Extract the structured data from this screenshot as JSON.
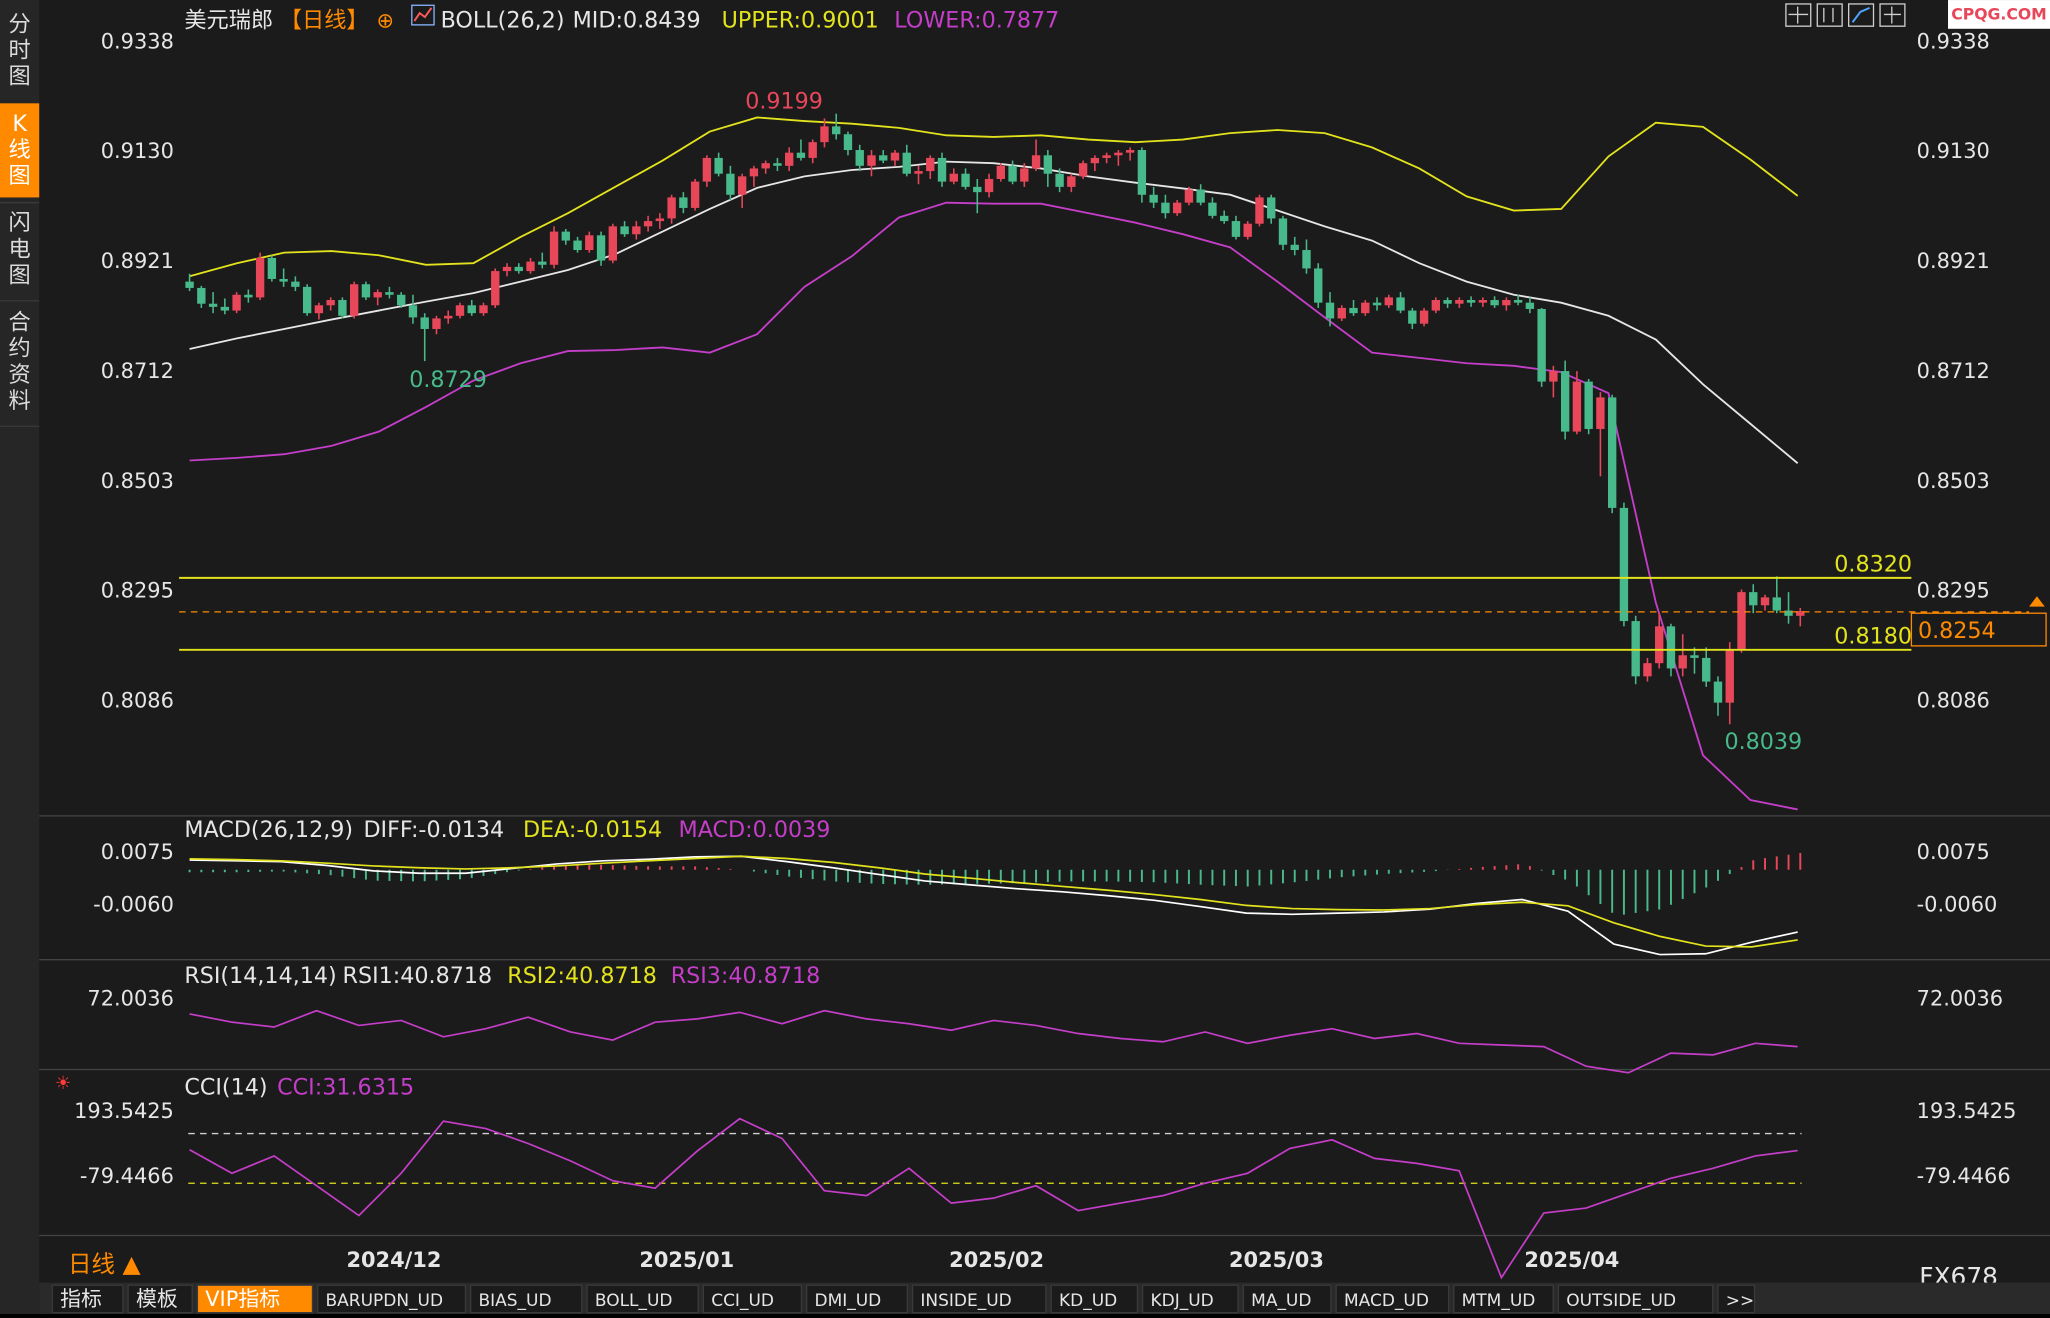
{
  "header": {
    "symbol": "美元瑞郎",
    "period_tag": "【日线】",
    "boll": {
      "name": "BOLL(26,2)",
      "mid": "MID:0.8439",
      "upper": "UPPER:0.9001",
      "lower": "LOWER:0.7877"
    },
    "watermark": "CPQG.COM"
  },
  "left_tabs": [
    {
      "label": "分\n时\n图",
      "active": false
    },
    {
      "label": "K\n线\n图",
      "active": true
    },
    {
      "label": "闪\n电\n图",
      "active": false
    },
    {
      "label": "合\n约\n资\n料",
      "active": false
    }
  ],
  "price_axis": [
    "0.9338",
    "0.9130",
    "0.8921",
    "0.8712",
    "0.8503",
    "0.8295",
    "0.8086"
  ],
  "price_annotations": {
    "high": "0.9199",
    "low_early": "0.8729",
    "low": "0.8039",
    "line_upper": "0.8320",
    "line_lower": "0.8180",
    "current": "0.8254"
  },
  "macd": {
    "header": "MACD(26,12,9)",
    "diff": "DIFF:-0.0134",
    "dea": "DEA:-0.0154",
    "macd": "MACD:0.0039",
    "axis": [
      "0.0075",
      "-0.0060"
    ]
  },
  "rsi": {
    "header": "RSI(14,14,14)",
    "rsi1": "RSI1:40.8718",
    "rsi2": "RSI2:40.8718",
    "rsi3": "RSI3:40.8718",
    "axis": [
      "72.0036"
    ]
  },
  "cci": {
    "header": "CCI(14)",
    "value": "CCI:31.6315",
    "axis": [
      "193.5425",
      "-79.4466"
    ]
  },
  "x_axis": [
    "2024/12",
    "2025/01",
    "2025/02",
    "2025/03",
    "2025/04"
  ],
  "period_label": "日线 ▲",
  "product": "FX678",
  "bottom_tabs": [
    "指标",
    "模板",
    "VIP指标",
    "BARUPDN_UD",
    "BIAS_UD",
    "BOLL_UD",
    "CCI_UD",
    "DMI_UD",
    "INSIDE_UD",
    "KD_UD",
    "KDJ_UD",
    "MA_UD",
    "MACD_UD",
    "MTM_UD",
    "OUTSIDE_UD",
    ">>"
  ],
  "colors": {
    "up": "#e8475a",
    "down": "#48b98a",
    "upper": "#e3e31d",
    "mid": "#e6e6e6",
    "lower": "#c53ec9",
    "accent": "#ff8a00"
  },
  "chart_data": {
    "type": "candlestick",
    "ylim": [
      0.795,
      0.9338
    ],
    "candles": [
      [
        0.888,
        0.8895,
        0.8862,
        0.8868
      ],
      [
        0.8868,
        0.8872,
        0.883,
        0.8838
      ],
      [
        0.8838,
        0.886,
        0.882,
        0.8832
      ],
      [
        0.8832,
        0.8848,
        0.8818,
        0.8825
      ],
      [
        0.8825,
        0.886,
        0.882,
        0.8855
      ],
      [
        0.8855,
        0.8865,
        0.884,
        0.885
      ],
      [
        0.885,
        0.8935,
        0.8845,
        0.8925
      ],
      [
        0.8925,
        0.893,
        0.888,
        0.8885
      ],
      [
        0.8885,
        0.8905,
        0.887,
        0.888
      ],
      [
        0.888,
        0.889,
        0.8862,
        0.887
      ],
      [
        0.887,
        0.8875,
        0.8815,
        0.882
      ],
      [
        0.882,
        0.884,
        0.8808,
        0.8835
      ],
      [
        0.8835,
        0.885,
        0.8825,
        0.8845
      ],
      [
        0.8845,
        0.885,
        0.881,
        0.8815
      ],
      [
        0.8815,
        0.888,
        0.881,
        0.8875
      ],
      [
        0.8875,
        0.888,
        0.8845,
        0.885
      ],
      [
        0.885,
        0.8865,
        0.8835,
        0.886
      ],
      [
        0.886,
        0.887,
        0.8848,
        0.8855
      ],
      [
        0.8855,
        0.886,
        0.883,
        0.8835
      ],
      [
        0.8835,
        0.8855,
        0.88,
        0.8812
      ],
      [
        0.8812,
        0.882,
        0.8729,
        0.879
      ],
      [
        0.879,
        0.8815,
        0.878,
        0.881
      ],
      [
        0.881,
        0.8825,
        0.88,
        0.8815
      ],
      [
        0.8815,
        0.884,
        0.881,
        0.8835
      ],
      [
        0.8835,
        0.8845,
        0.8815,
        0.882
      ],
      [
        0.882,
        0.884,
        0.8815,
        0.8835
      ],
      [
        0.8835,
        0.8905,
        0.883,
        0.89
      ],
      [
        0.89,
        0.8915,
        0.889,
        0.8908
      ],
      [
        0.8908,
        0.8915,
        0.8895,
        0.89
      ],
      [
        0.89,
        0.8925,
        0.8895,
        0.8918
      ],
      [
        0.8918,
        0.8935,
        0.8905,
        0.8912
      ],
      [
        0.8912,
        0.8985,
        0.8905,
        0.8975
      ],
      [
        0.8975,
        0.898,
        0.895,
        0.8958
      ],
      [
        0.8958,
        0.8965,
        0.8935,
        0.894
      ],
      [
        0.894,
        0.8975,
        0.8935,
        0.8968
      ],
      [
        0.8968,
        0.8975,
        0.891,
        0.892
      ],
      [
        0.892,
        0.899,
        0.8915,
        0.8985
      ],
      [
        0.8985,
        0.8995,
        0.8965,
        0.897
      ],
      [
        0.897,
        0.8995,
        0.896,
        0.8985
      ],
      [
        0.8985,
        0.9005,
        0.8975,
        0.8995
      ],
      [
        0.8995,
        0.901,
        0.898,
        0.9
      ],
      [
        0.9,
        0.9045,
        0.899,
        0.904
      ],
      [
        0.904,
        0.905,
        0.901,
        0.902
      ],
      [
        0.902,
        0.9075,
        0.9015,
        0.907
      ],
      [
        0.907,
        0.912,
        0.906,
        0.9115
      ],
      [
        0.9115,
        0.9125,
        0.908,
        0.9085
      ],
      [
        0.9085,
        0.91,
        0.9035,
        0.9045
      ],
      [
        0.9045,
        0.9085,
        0.902,
        0.908
      ],
      [
        0.908,
        0.91,
        0.906,
        0.9095
      ],
      [
        0.9095,
        0.911,
        0.9085,
        0.9105
      ],
      [
        0.9105,
        0.9115,
        0.909,
        0.91
      ],
      [
        0.91,
        0.9135,
        0.909,
        0.9125
      ],
      [
        0.9125,
        0.915,
        0.911,
        0.9115
      ],
      [
        0.9115,
        0.915,
        0.9105,
        0.9145
      ],
      [
        0.9145,
        0.919,
        0.9135,
        0.9175
      ],
      [
        0.9175,
        0.9199,
        0.915,
        0.916
      ],
      [
        0.916,
        0.9165,
        0.912,
        0.913
      ],
      [
        0.913,
        0.914,
        0.909,
        0.91
      ],
      [
        0.91,
        0.913,
        0.908,
        0.912
      ],
      [
        0.912,
        0.913,
        0.9105,
        0.911
      ],
      [
        0.911,
        0.913,
        0.91,
        0.9125
      ],
      [
        0.9125,
        0.914,
        0.908,
        0.9085
      ],
      [
        0.9085,
        0.91,
        0.9065,
        0.909
      ],
      [
        0.909,
        0.912,
        0.9075,
        0.9115
      ],
      [
        0.9115,
        0.9125,
        0.906,
        0.907
      ],
      [
        0.907,
        0.9095,
        0.9065,
        0.9085
      ],
      [
        0.9085,
        0.9095,
        0.9055,
        0.906
      ],
      [
        0.906,
        0.9075,
        0.901,
        0.905
      ],
      [
        0.905,
        0.9085,
        0.904,
        0.9075
      ],
      [
        0.9075,
        0.9105,
        0.907,
        0.91
      ],
      [
        0.91,
        0.911,
        0.9065,
        0.907
      ],
      [
        0.907,
        0.9105,
        0.906,
        0.9095
      ],
      [
        0.9095,
        0.915,
        0.909,
        0.912
      ],
      [
        0.912,
        0.913,
        0.906,
        0.9085
      ],
      [
        0.9085,
        0.9095,
        0.905,
        0.906
      ],
      [
        0.906,
        0.9085,
        0.905,
        0.908
      ],
      [
        0.908,
        0.911,
        0.9075,
        0.9105
      ],
      [
        0.9105,
        0.912,
        0.909,
        0.9115
      ],
      [
        0.9115,
        0.9125,
        0.9105,
        0.912
      ],
      [
        0.912,
        0.913,
        0.91,
        0.9125
      ],
      [
        0.9125,
        0.9135,
        0.911,
        0.913
      ],
      [
        0.913,
        0.9135,
        0.903,
        0.9045
      ],
      [
        0.9045,
        0.906,
        0.902,
        0.903
      ],
      [
        0.903,
        0.9045,
        0.9,
        0.901
      ],
      [
        0.901,
        0.9035,
        0.9005,
        0.903
      ],
      [
        0.903,
        0.906,
        0.9025,
        0.9055
      ],
      [
        0.9055,
        0.9065,
        0.9025,
        0.903
      ],
      [
        0.903,
        0.904,
        0.9,
        0.9005
      ],
      [
        0.9005,
        0.9015,
        0.899,
        0.8995
      ],
      [
        0.8995,
        0.9005,
        0.896,
        0.8965
      ],
      [
        0.8965,
        0.8995,
        0.896,
        0.899
      ],
      [
        0.899,
        0.9045,
        0.8985,
        0.904
      ],
      [
        0.904,
        0.9045,
        0.899,
        0.9
      ],
      [
        0.9,
        0.9005,
        0.894,
        0.895
      ],
      [
        0.895,
        0.8965,
        0.893,
        0.894
      ],
      [
        0.894,
        0.896,
        0.8895,
        0.8905
      ],
      [
        0.8905,
        0.8915,
        0.883,
        0.884
      ],
      [
        0.884,
        0.886,
        0.8795,
        0.881
      ],
      [
        0.881,
        0.8835,
        0.8805,
        0.883
      ],
      [
        0.883,
        0.8845,
        0.8815,
        0.882
      ],
      [
        0.882,
        0.8845,
        0.8815,
        0.884
      ],
      [
        0.884,
        0.885,
        0.8825,
        0.8835
      ],
      [
        0.8835,
        0.8855,
        0.883,
        0.885
      ],
      [
        0.885,
        0.886,
        0.882,
        0.8825
      ],
      [
        0.8825,
        0.883,
        0.879,
        0.88
      ],
      [
        0.88,
        0.883,
        0.8795,
        0.8825
      ],
      [
        0.8825,
        0.885,
        0.882,
        0.8845
      ],
      [
        0.8845,
        0.885,
        0.883,
        0.8838
      ],
      [
        0.8838,
        0.885,
        0.883,
        0.8845
      ],
      [
        0.8845,
        0.8852,
        0.8832,
        0.884
      ],
      [
        0.884,
        0.885,
        0.8832,
        0.8845
      ],
      [
        0.8845,
        0.8852,
        0.883,
        0.8835
      ],
      [
        0.8835,
        0.885,
        0.8825,
        0.8845
      ],
      [
        0.8845,
        0.8855,
        0.8835,
        0.884
      ],
      [
        0.884,
        0.885,
        0.882,
        0.8828
      ],
      [
        0.8828,
        0.883,
        0.868,
        0.869
      ],
      [
        0.869,
        0.872,
        0.866,
        0.871
      ],
      [
        0.871,
        0.873,
        0.858,
        0.8595
      ],
      [
        0.8595,
        0.871,
        0.859,
        0.869
      ],
      [
        0.869,
        0.8695,
        0.859,
        0.86
      ],
      [
        0.86,
        0.867,
        0.851,
        0.866
      ],
      [
        0.866,
        0.8665,
        0.844,
        0.845
      ],
      [
        0.845,
        0.846,
        0.8225,
        0.8235
      ],
      [
        0.8235,
        0.8245,
        0.8115,
        0.813
      ],
      [
        0.813,
        0.8165,
        0.812,
        0.8155
      ],
      [
        0.8155,
        0.825,
        0.8145,
        0.8225
      ],
      [
        0.8225,
        0.823,
        0.813,
        0.8145
      ],
      [
        0.8145,
        0.821,
        0.813,
        0.817
      ],
      [
        0.817,
        0.8185,
        0.8135,
        0.8165
      ],
      [
        0.8165,
        0.8185,
        0.811,
        0.812
      ],
      [
        0.812,
        0.813,
        0.8055,
        0.808
      ],
      [
        0.808,
        0.8195,
        0.8039,
        0.8182
      ],
      [
        0.8182,
        0.8295,
        0.8175,
        0.829
      ],
      [
        0.829,
        0.8305,
        0.825,
        0.8265
      ],
      [
        0.8265,
        0.8285,
        0.8255,
        0.828
      ],
      [
        0.828,
        0.832,
        0.825,
        0.8255
      ],
      [
        0.8255,
        0.829,
        0.823,
        0.8245
      ],
      [
        0.8245,
        0.826,
        0.8225,
        0.8254
      ]
    ],
    "boll_upper": [
      0.889,
      0.8915,
      0.8935,
      0.8938,
      0.893,
      0.8912,
      0.8915,
      0.8965,
      0.901,
      0.906,
      0.911,
      0.9165,
      0.9192,
      0.9185,
      0.918,
      0.9172,
      0.9158,
      0.9155,
      0.9158,
      0.915,
      0.9145,
      0.915,
      0.9162,
      0.9168,
      0.9162,
      0.9135,
      0.9095,
      0.9042,
      0.9015,
      0.9018,
      0.9118,
      0.9182,
      0.9174,
      0.9112,
      0.9043
    ],
    "boll_mid": [
      0.8752,
      0.8772,
      0.879,
      0.8808,
      0.8825,
      0.8842,
      0.8858,
      0.888,
      0.8902,
      0.8932,
      0.8975,
      0.9018,
      0.9058,
      0.908,
      0.9092,
      0.9098,
      0.9108,
      0.9105,
      0.9095,
      0.908,
      0.9068,
      0.9057,
      0.9045,
      0.9015,
      0.8985,
      0.8958,
      0.8915,
      0.888,
      0.8855,
      0.884,
      0.8815,
      0.877,
      0.8685,
      0.861,
      0.8535
    ],
    "boll_lower": [
      0.854,
      0.8545,
      0.8552,
      0.8568,
      0.8595,
      0.8642,
      0.8692,
      0.8725,
      0.8748,
      0.875,
      0.8755,
      0.8745,
      0.878,
      0.887,
      0.8928,
      0.9002,
      0.903,
      0.9028,
      0.9028,
      0.901,
      0.8992,
      0.897,
      0.8945,
      0.888,
      0.8812,
      0.8745,
      0.8735,
      0.8725,
      0.872,
      0.8708,
      0.8668,
      0.827,
      0.798,
      0.7895,
      0.7877
    ],
    "diff": [
      0.0052,
      0.005,
      0.0048,
      0.0038,
      0.0024,
      0.0018,
      0.0018,
      0.003,
      0.0042,
      0.005,
      0.0054,
      0.006,
      0.0062,
      0.0048,
      0.0032,
      0.0015,
      -0.0002,
      -0.0012,
      -0.0022,
      -0.003,
      -0.004,
      -0.0052,
      -0.0068,
      -0.0085,
      -0.0088,
      -0.0085,
      -0.0082,
      -0.0075,
      -0.006,
      -0.005,
      -0.008,
      -0.0165,
      -0.0192,
      -0.019,
      -0.016,
      -0.0134
    ],
    "dea": [
      0.0055,
      0.0053,
      0.005,
      0.0044,
      0.0037,
      0.0032,
      0.0029,
      0.0032,
      0.0037,
      0.0044,
      0.005,
      0.0056,
      0.0062,
      0.0056,
      0.0046,
      0.0032,
      0.0016,
      0.0005,
      -0.0006,
      -0.0016,
      -0.0026,
      -0.0037,
      -0.005,
      -0.0065,
      -0.0073,
      -0.0076,
      -0.0077,
      -0.0073,
      -0.0063,
      -0.0057,
      -0.0066,
      -0.011,
      -0.0145,
      -0.017,
      -0.0172,
      -0.0154
    ],
    "rsi": [
      62,
      57,
      54,
      64,
      55,
      58,
      48,
      53,
      60,
      51,
      46,
      57,
      59,
      63,
      56,
      64,
      59,
      56,
      52,
      58,
      55,
      50,
      47,
      45,
      51,
      44,
      49,
      53,
      47,
      50,
      44,
      43,
      42,
      30,
      26,
      38,
      37,
      44,
      42
    ],
    "cci": [
      35,
      -60,
      10,
      -110,
      -230,
      -60,
      150,
      120,
      60,
      -10,
      -90,
      -120,
      30,
      160,
      80,
      -130,
      -150,
      -40,
      -180,
      -160,
      -110,
      -210,
      -180,
      -150,
      -100,
      -60,
      40,
      75,
      0,
      -20,
      -50,
      -480,
      -220,
      -200,
      -140,
      -80,
      -40,
      10,
      31.6315
    ]
  }
}
